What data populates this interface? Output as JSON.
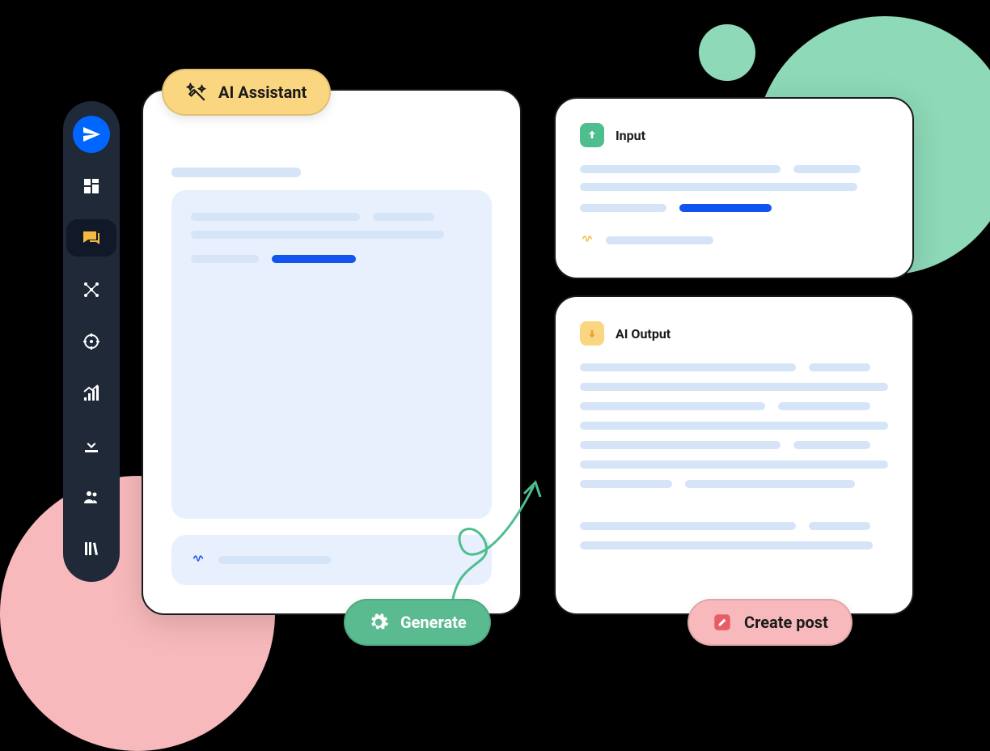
{
  "sidebar": {
    "items": [
      {
        "name": "navigate",
        "icon": "paper-plane"
      },
      {
        "name": "dashboard",
        "icon": "grid"
      },
      {
        "name": "compose",
        "icon": "message-edit",
        "active": true
      },
      {
        "name": "network",
        "icon": "nodes"
      },
      {
        "name": "target",
        "icon": "crosshair"
      },
      {
        "name": "analytics",
        "icon": "chart-up"
      },
      {
        "name": "downloads",
        "icon": "download-tray"
      },
      {
        "name": "team",
        "icon": "users"
      },
      {
        "name": "library",
        "icon": "books"
      }
    ]
  },
  "pills": {
    "ai_assistant": "AI Assistant",
    "generate": "Generate",
    "create_post": "Create post"
  },
  "cards": {
    "input": {
      "label": "Input"
    },
    "output": {
      "label": "AI Output"
    }
  },
  "colors": {
    "accent_blue": "#0066FF",
    "accent_green": "#5ABB91",
    "accent_pink": "#F8B9BC",
    "accent_yellow": "#FBD681",
    "skeleton_light": "#D6E4F7",
    "skeleton_blue": "#1155EE"
  }
}
